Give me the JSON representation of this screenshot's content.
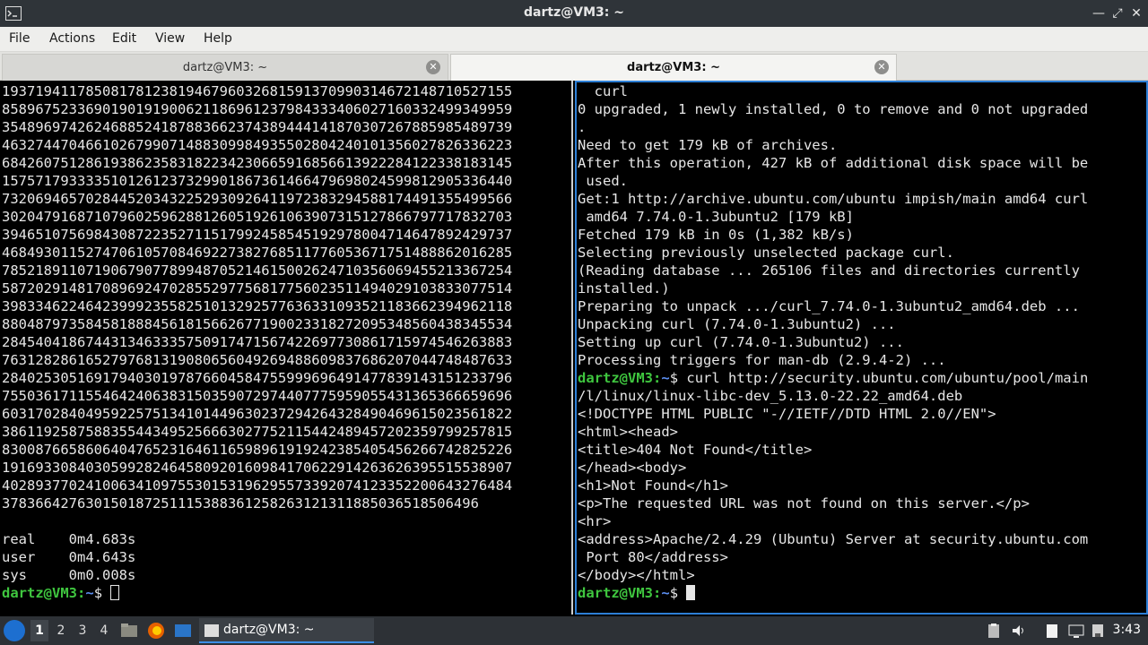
{
  "window": {
    "title": "dartz@VM3: ~"
  },
  "menu": [
    "File",
    "Actions",
    "Edit",
    "View",
    "Help"
  ],
  "tabs": [
    {
      "label": "dartz@VM3: ~"
    },
    {
      "label": "dartz@VM3: ~"
    }
  ],
  "left_terminal": {
    "lines": [
      "1937194117850817812381946796032681591370990314672148710527155",
      "8589675233690190191900621186961237984333406027160332499349959",
      "3548969742624688524187883662374389444141870307267885985489739",
      "4632744704661026799071488309984935502804240101356027826336223",
      "6842607512861938623583182234230665916856613922284122338183145",
      "1575717933335101261237329901867361466479698024599812905336440",
      "7320694657028445203432252930926411972383294588174491355499566",
      "3020479168710796025962881260519261063907315127866797717832703",
      "3946510756984308722352711517992458545192978004714647892429737",
      "4684930115274706105708469227382768511776053671751488862016285",
      "7852189110719067907789948705214615002624710356069455213367254",
      "5872029148170896924702855297756817756023511494029103833077514",
      "3983346224642399923558251013292577636331093521183662394962118",
      "8804879735845818884561815662677190023318272095348560438345534",
      "2845404186744313463335750917471567422697730861715974546263883",
      "7631282861652797681319080656049269488609837686207044748487633",
      "2840253051691794030197876604584755999696491477839143151233796",
      "7550361711554642406383150359072974407775959055431365366659696",
      "6031702840495922575134101449630237294264328490469615023561822",
      "3861192587588355443495256663027752115442489457202359799257815",
      "8300876658606404765231646116598961919242385405456266742825226",
      "1916933084030599282464580920160984170622914263626395515538907",
      "4028937702410063410975530153196295573392074123352200643276484",
      "378366427630150187251115388361258263121311885036518506496",
      "",
      "real    0m4.683s",
      "user    0m4.643s",
      "sys     0m0.008s"
    ],
    "prompt_user": "dartz@VM3",
    "prompt_sep": ":",
    "prompt_path": "~",
    "prompt_end": "$ "
  },
  "right_terminal": {
    "lines": [
      "  curl",
      "0 upgraded, 1 newly installed, 0 to remove and 0 not upgraded",
      ".",
      "Need to get 179 kB of archives.",
      "After this operation, 427 kB of additional disk space will be",
      " used.",
      "Get:1 http://archive.ubuntu.com/ubuntu impish/main amd64 curl",
      " amd64 7.74.0-1.3ubuntu2 [179 kB]",
      "Fetched 179 kB in 0s (1,382 kB/s)",
      "Selecting previously unselected package curl.",
      "(Reading database ... 265106 files and directories currently",
      "installed.)",
      "Preparing to unpack .../curl_7.74.0-1.3ubuntu2_amd64.deb ...",
      "Unpacking curl (7.74.0-1.3ubuntu2) ...",
      "Setting up curl (7.74.0-1.3ubuntu2) ...",
      "Processing triggers for man-db (2.9.4-2) ..."
    ],
    "command_line_1": "curl http://security.ubuntu.com/ubuntu/pool/main",
    "command_line_2": "/l/linux/linux-libc-dev_5.13.0-22.22_amd64.deb",
    "output_lines": [
      "<!DOCTYPE HTML PUBLIC \"-//IETF//DTD HTML 2.0//EN\">",
      "<html><head>",
      "<title>404 Not Found</title>",
      "</head><body>",
      "<h1>Not Found</h1>",
      "<p>The requested URL was not found on this server.</p>",
      "<hr>",
      "<address>Apache/2.4.29 (Ubuntu) Server at security.ubuntu.com",
      " Port 80</address>",
      "</body></html>"
    ],
    "prompt_user": "dartz@VM3",
    "prompt_sep": ":",
    "prompt_path": "~",
    "prompt_end": "$ "
  },
  "taskbar": {
    "workspaces": [
      "1",
      "2",
      "3",
      "4"
    ],
    "task_label": "dartz@VM3: ~",
    "clock": "3:43"
  },
  "colors": {
    "prompt_user": "#3fc63f",
    "prompt_path": "#5b8ef0",
    "focus_border": "#2d7fd6"
  }
}
